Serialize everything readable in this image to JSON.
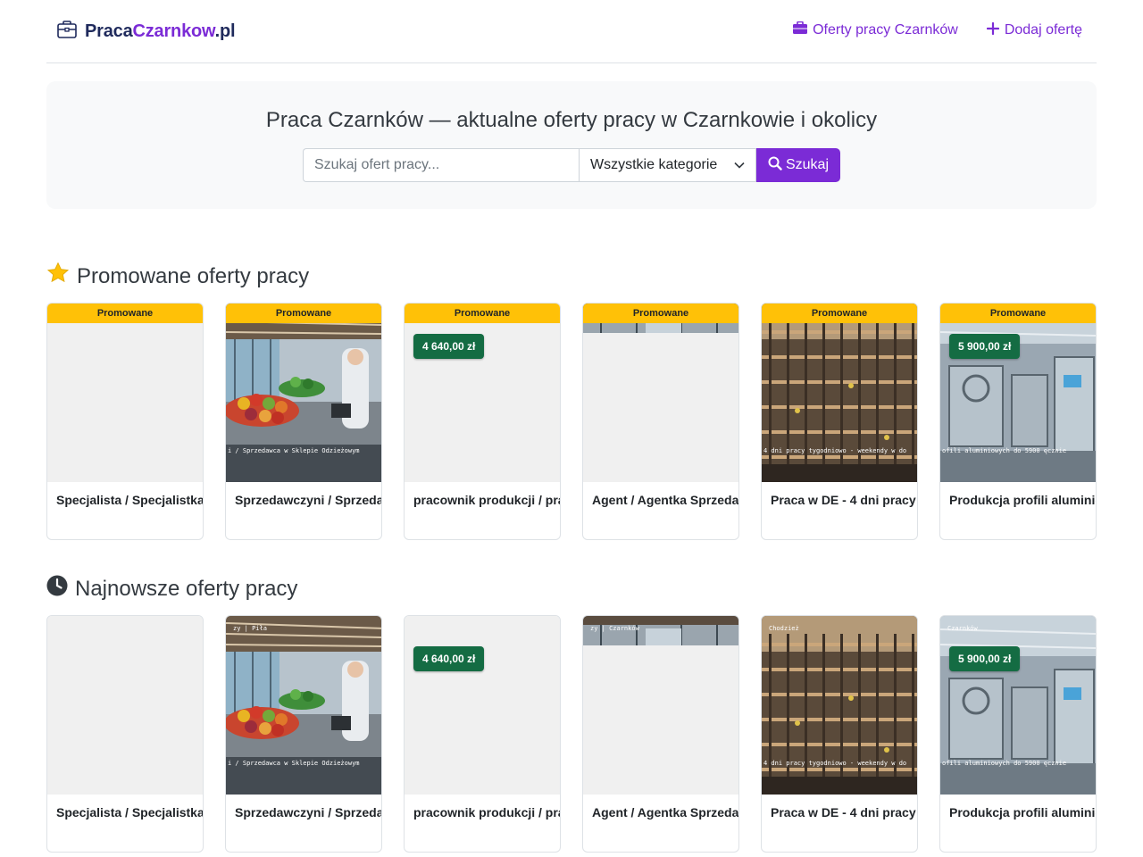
{
  "brand": {
    "part1": "Praca",
    "part2": "Czarnkow",
    "part3": ".pl"
  },
  "nav": {
    "offers_label": "Oferty pracy Czarnków",
    "add_label": "Dodaj ofertę"
  },
  "hero": {
    "title": "Praca Czarnków — aktualne oferty pracy w Czarnkowie i okolicy",
    "search_placeholder": "Szukaj ofert pracy...",
    "category_selected": "Wszystkie kategorie",
    "search_button": "Szukaj"
  },
  "promoted": {
    "title": "Promowane oferty pracy",
    "badge": "Promowane",
    "cards": [
      {
        "title": "Specjalista / Specjalistka",
        "price": "",
        "image": "blank",
        "caption": ""
      },
      {
        "title": "Sprzedawczyni / Sprzedawca",
        "price": "",
        "image": "store",
        "caption": "i / Sprzedawca w Sklepie Odzieżowym"
      },
      {
        "title": "pracownik produkcji / pracownica",
        "price": "4 640,00 zł",
        "image": "blank",
        "caption": ""
      },
      {
        "title": "Agent / Agentka Sprzedaży",
        "price": "",
        "image": "hall-strip",
        "caption": ""
      },
      {
        "title": "Praca w DE - 4 dni pracy",
        "price": "",
        "image": "construction",
        "caption": "4 dni pracy tygodniowo - weekendy w do"
      },
      {
        "title": "Produkcja profili aluminiowych",
        "price": "5 900,00 zł",
        "image": "factory",
        "caption": "ofili aluminiowych do 5900 ęcznie"
      }
    ]
  },
  "latest": {
    "title": "Najnowsze oferty pracy",
    "cards": [
      {
        "title": "Specjalista / Specjalistka",
        "price": "",
        "image": "blank",
        "caption": "",
        "tag": ""
      },
      {
        "title": "Sprzedawczyni / Sprzedawca",
        "price": "",
        "image": "store",
        "caption": "i / Sprzedawca w Sklepie Odzieżowym",
        "tag": "zy | Piła"
      },
      {
        "title": "pracownik produkcji / pracownica",
        "price": "4 640,00 zł",
        "image": "blank",
        "caption": "",
        "tag": ""
      },
      {
        "title": "Agent / Agentka Sprzedaży",
        "price": "",
        "image": "hall-strip",
        "caption": "",
        "tag": "zy | Czarnków"
      },
      {
        "title": "Praca w DE - 4 dni pracy",
        "price": "",
        "image": "construction",
        "caption": "4 dni pracy tygodniowo - weekendy w do",
        "tag": "Chodzież"
      },
      {
        "title": "Produkcja profili aluminiowych",
        "price": "5 900,00 zł",
        "image": "factory",
        "caption": "ofili aluminiowych do 5900 ęcznie",
        "tag": "Czarnków"
      }
    ]
  },
  "colors": {
    "accent": "#7b2bd6",
    "promo": "#ffc107",
    "price": "#146c43"
  }
}
